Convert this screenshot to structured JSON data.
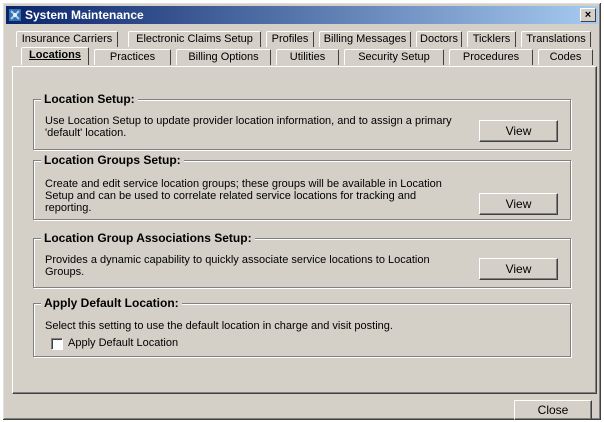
{
  "window": {
    "title": "System Maintenance",
    "close_glyph": "×"
  },
  "tabs_row1": [
    "Insurance Carriers",
    "Electronic Claims Setup",
    "Profiles",
    "Billing Messages",
    "Doctors",
    "Ticklers",
    "Translations"
  ],
  "tabs_row2": [
    "Locations",
    "Practices",
    "Billing Options",
    "Utilities",
    "Security Setup",
    "Procedures",
    "Codes"
  ],
  "active_tab": "Locations",
  "groups": {
    "location_setup": {
      "title": "Location Setup:",
      "desc_line1": "Use Location Setup to update provider location information, and to assign a primary",
      "desc_line2": "'default' location.",
      "button": "View"
    },
    "location_groups": {
      "title": "Location Groups Setup:",
      "desc_line1": "Create and edit service location groups; these groups will be available in Location",
      "desc_line2": "Setup and can be used to correlate related service locations for tracking and",
      "desc_line3": "reporting.",
      "button": "View"
    },
    "location_group_assoc": {
      "title": "Location Group Associations Setup:",
      "desc_line1": "Provides a dynamic capability to quickly associate service locations to Location",
      "desc_line2": "Groups.",
      "button": "View"
    },
    "apply_default": {
      "title": "Apply Default Location:",
      "desc": "Select this setting to use the default location in charge and visit posting.",
      "checkbox_label": "Apply Default Location",
      "checked": false
    }
  },
  "footer": {
    "close_button": "Close"
  }
}
